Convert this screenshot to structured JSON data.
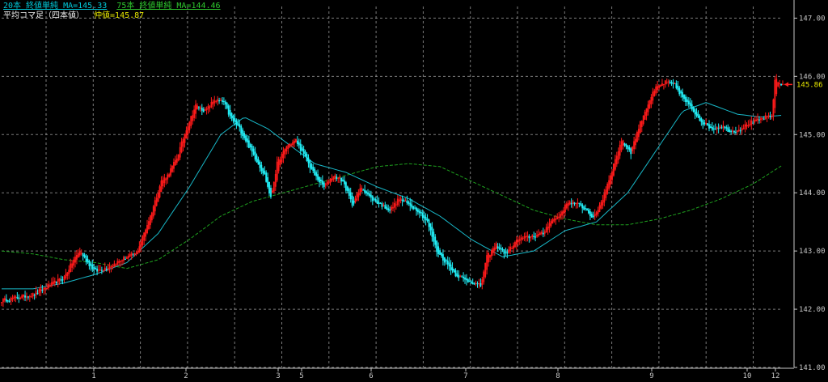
{
  "legend": {
    "ma20": "20本 終値単純 MA=145.33",
    "ma75": "75本 終値単純 MA=144.46",
    "heikin": "平均コマ足（四本値）",
    "mid": "仲値=145.87"
  },
  "colors": {
    "background": "#000000",
    "bull": "#ff1a1a",
    "bear": "#22f0f8",
    "ma20": "#18b8c8",
    "ma75": "#1ea01e",
    "grid": "#9a9a9a",
    "axis": "#c8c8c8",
    "price_marker": "#e8e800",
    "arrow": "#ff2020"
  },
  "chart_data": {
    "type": "candlestick",
    "ylim": [
      141.0,
      147.2
    ],
    "y_ticks": [
      "141.00",
      "142.00",
      "143.00",
      "144.00",
      "145.00",
      "146.00",
      "147.00"
    ],
    "x_ticks": [
      "1",
      "2",
      "3",
      "5",
      "6",
      "7",
      "8",
      "9",
      "10",
      "12"
    ],
    "current_price": "145.86",
    "grid": "dashed",
    "price_path": [
      [
        0,
        142.15
      ],
      [
        10,
        142.2
      ],
      [
        20,
        142.25
      ],
      [
        30,
        142.4
      ],
      [
        40,
        142.55
      ],
      [
        46,
        142.85
      ],
      [
        50,
        143.0
      ],
      [
        55,
        142.8
      ],
      [
        60,
        142.65
      ],
      [
        70,
        142.75
      ],
      [
        80,
        142.9
      ],
      [
        86,
        142.95
      ],
      [
        95,
        143.6
      ],
      [
        102,
        144.2
      ],
      [
        106,
        144.3
      ],
      [
        112,
        144.6
      ],
      [
        118,
        145.1
      ],
      [
        124,
        145.5
      ],
      [
        130,
        145.4
      ],
      [
        136,
        145.6
      ],
      [
        142,
        145.55
      ],
      [
        146,
        145.3
      ],
      [
        152,
        145.1
      ],
      [
        160,
        144.7
      ],
      [
        168,
        144.3
      ],
      [
        172,
        143.9
      ],
      [
        176,
        144.5
      ],
      [
        182,
        144.8
      ],
      [
        188,
        144.9
      ],
      [
        194,
        144.6
      ],
      [
        200,
        144.3
      ],
      [
        206,
        144.1
      ],
      [
        212,
        144.3
      ],
      [
        218,
        144.2
      ],
      [
        224,
        143.8
      ],
      [
        230,
        144.1
      ],
      [
        236,
        143.9
      ],
      [
        242,
        143.8
      ],
      [
        248,
        143.7
      ],
      [
        254,
        143.9
      ],
      [
        260,
        143.8
      ],
      [
        266,
        143.7
      ],
      [
        272,
        143.5
      ],
      [
        278,
        143.0
      ],
      [
        284,
        142.8
      ],
      [
        290,
        142.6
      ],
      [
        296,
        142.5
      ],
      [
        302,
        142.45
      ],
      [
        306,
        142.4
      ],
      [
        310,
        142.9
      ],
      [
        316,
        143.1
      ],
      [
        322,
        142.95
      ],
      [
        330,
        143.2
      ],
      [
        338,
        143.25
      ],
      [
        346,
        143.3
      ],
      [
        350,
        143.5
      ],
      [
        356,
        143.6
      ],
      [
        362,
        143.85
      ],
      [
        368,
        143.8
      ],
      [
        374,
        143.7
      ],
      [
        378,
        143.55
      ],
      [
        384,
        143.9
      ],
      [
        390,
        144.4
      ],
      [
        396,
        144.9
      ],
      [
        402,
        144.7
      ],
      [
        408,
        145.2
      ],
      [
        414,
        145.6
      ],
      [
        418,
        145.8
      ],
      [
        424,
        145.9
      ],
      [
        430,
        145.85
      ],
      [
        436,
        145.6
      ],
      [
        442,
        145.4
      ],
      [
        448,
        145.2
      ],
      [
        454,
        145.1
      ],
      [
        460,
        145.15
      ],
      [
        466,
        145.05
      ],
      [
        472,
        145.1
      ],
      [
        478,
        145.2
      ],
      [
        484,
        145.25
      ],
      [
        488,
        145.3
      ],
      [
        492,
        145.3
      ],
      [
        494,
        145.95
      ],
      [
        498,
        145.86
      ]
    ],
    "ma20_path": [
      [
        0,
        142.35
      ],
      [
        20,
        142.35
      ],
      [
        40,
        142.45
      ],
      [
        60,
        142.6
      ],
      [
        80,
        142.8
      ],
      [
        100,
        143.3
      ],
      [
        120,
        144.1
      ],
      [
        140,
        145.0
      ],
      [
        155,
        145.3
      ],
      [
        170,
        145.1
      ],
      [
        185,
        144.8
      ],
      [
        200,
        144.5
      ],
      [
        220,
        144.35
      ],
      [
        240,
        144.1
      ],
      [
        260,
        143.9
      ],
      [
        280,
        143.6
      ],
      [
        300,
        143.2
      ],
      [
        320,
        142.9
      ],
      [
        340,
        143.0
      ],
      [
        360,
        143.35
      ],
      [
        380,
        143.5
      ],
      [
        400,
        144.0
      ],
      [
        420,
        144.8
      ],
      [
        435,
        145.4
      ],
      [
        450,
        145.55
      ],
      [
        470,
        145.35
      ],
      [
        485,
        145.3
      ],
      [
        498,
        145.33
      ]
    ],
    "ma75_path": [
      [
        0,
        143.0
      ],
      [
        20,
        142.95
      ],
      [
        40,
        142.85
      ],
      [
        60,
        142.8
      ],
      [
        80,
        142.7
      ],
      [
        100,
        142.85
      ],
      [
        120,
        143.2
      ],
      [
        140,
        143.6
      ],
      [
        160,
        143.85
      ],
      [
        180,
        144.0
      ],
      [
        200,
        144.15
      ],
      [
        220,
        144.3
      ],
      [
        240,
        144.45
      ],
      [
        260,
        144.5
      ],
      [
        280,
        144.45
      ],
      [
        300,
        144.2
      ],
      [
        320,
        143.95
      ],
      [
        340,
        143.7
      ],
      [
        360,
        143.55
      ],
      [
        380,
        143.45
      ],
      [
        400,
        143.45
      ],
      [
        420,
        143.55
      ],
      [
        440,
        143.7
      ],
      [
        460,
        143.9
      ],
      [
        480,
        144.15
      ],
      [
        498,
        144.46
      ]
    ]
  }
}
